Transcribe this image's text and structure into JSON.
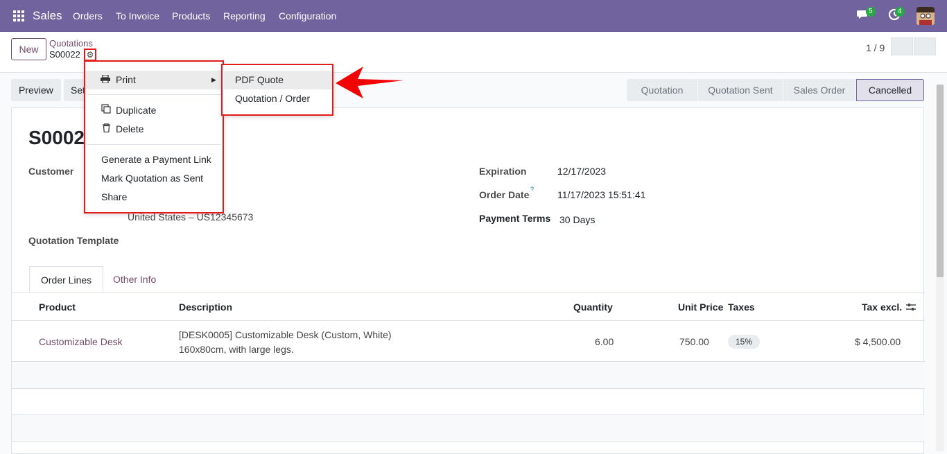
{
  "topbar": {
    "app": "Sales",
    "menus": [
      "Orders",
      "To Invoice",
      "Products",
      "Reporting",
      "Configuration"
    ],
    "chat_badge": "5",
    "activity_badge": "4",
    "color": "#71639e"
  },
  "control": {
    "new_label": "New",
    "breadcrumb": "Quotations",
    "record": "S00022",
    "pager": "1 / 9"
  },
  "status": {
    "preview": "Preview",
    "send": "Set",
    "stages": [
      "Quotation",
      "Quotation Sent",
      "Sales Order",
      "Cancelled"
    ],
    "active_stage": "Cancelled"
  },
  "form": {
    "title": "S00022",
    "customer_label": "Customer",
    "address_tail": "United States – US12345673",
    "template_label": "Quotation Template",
    "expiration_label": "Expiration",
    "expiration": "12/17/2023",
    "order_date_label": "Order Date",
    "order_date_help": "?",
    "order_date": "11/17/2023 15:51:41",
    "terms_label": "Payment Terms",
    "terms": "30 Days"
  },
  "tabs": [
    "Order Lines",
    "Other Info"
  ],
  "table": {
    "headers": [
      "Product",
      "Description",
      "Quantity",
      "Unit Price",
      "Taxes",
      "Tax excl."
    ],
    "row": {
      "product": "Customizable Desk",
      "desc1": "[DESK0005] Customizable Desk (Custom, White)",
      "desc2": "160x80cm, with large legs.",
      "qty": "6.00",
      "price": "750.00",
      "tax": "15%",
      "subtotal": "$ 4,500.00"
    }
  },
  "dropdown": {
    "print": "Print",
    "duplicate": "Duplicate",
    "delete": "Delete",
    "payment_link": "Generate a Payment Link",
    "mark_sent": "Mark Quotation as Sent",
    "share": "Share"
  },
  "print_submenu": [
    "PDF Quote",
    "Quotation / Order"
  ],
  "annotation_color": "#e31b1b"
}
